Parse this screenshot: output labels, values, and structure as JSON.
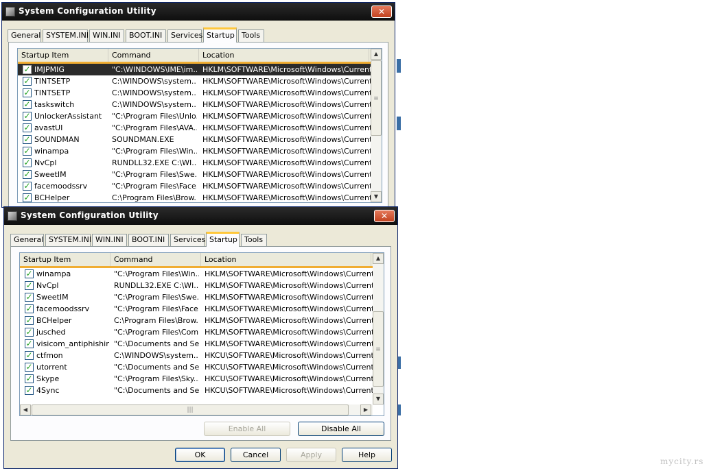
{
  "window_title": "System Configuration Utility",
  "close_glyph": "✕",
  "tabs": [
    "General",
    "SYSTEM.INI",
    "WIN.INI",
    "BOOT.INI",
    "Services",
    "Startup",
    "Tools"
  ],
  "active_tab": "Startup",
  "columns": [
    "Startup Item",
    "Command",
    "Location"
  ],
  "check_glyph": "✓",
  "top_window": {
    "rows": [
      {
        "item": "IMJPMIG",
        "command": "\"C:\\WINDOWS\\IME\\im...",
        "location": "HKLM\\SOFTWARE\\Microsoft\\Windows\\CurrentVer...",
        "checked": true
      },
      {
        "item": "TINTSETP",
        "command": "C:\\WINDOWS\\system...",
        "location": "HKLM\\SOFTWARE\\Microsoft\\Windows\\CurrentVer...",
        "checked": true
      },
      {
        "item": "TINTSETP",
        "command": "C:\\WINDOWS\\system...",
        "location": "HKLM\\SOFTWARE\\Microsoft\\Windows\\CurrentVer...",
        "checked": true
      },
      {
        "item": "taskswitch",
        "command": "C:\\WINDOWS\\system...",
        "location": "HKLM\\SOFTWARE\\Microsoft\\Windows\\CurrentVer...",
        "checked": true
      },
      {
        "item": "UnlockerAssistant",
        "command": "\"C:\\Program Files\\Unlo...",
        "location": "HKLM\\SOFTWARE\\Microsoft\\Windows\\CurrentVer...",
        "checked": true
      },
      {
        "item": "avastUI",
        "command": "\"C:\\Program Files\\AVA...",
        "location": "HKLM\\SOFTWARE\\Microsoft\\Windows\\CurrentVer...",
        "checked": true
      },
      {
        "item": "SOUNDMAN",
        "command": "SOUNDMAN.EXE",
        "location": "HKLM\\SOFTWARE\\Microsoft\\Windows\\CurrentVer...",
        "checked": true
      },
      {
        "item": "winampa",
        "command": "\"C:\\Program Files\\Win...",
        "location": "HKLM\\SOFTWARE\\Microsoft\\Windows\\CurrentVer...",
        "checked": true
      },
      {
        "item": "NvCpl",
        "command": "RUNDLL32.EXE C:\\WI...",
        "location": "HKLM\\SOFTWARE\\Microsoft\\Windows\\CurrentVer...",
        "checked": true
      },
      {
        "item": "SweetIM",
        "command": "\"C:\\Program Files\\Swe...",
        "location": "HKLM\\SOFTWARE\\Microsoft\\Windows\\CurrentVer...",
        "checked": true
      },
      {
        "item": "facemoodssrv",
        "command": "\"C:\\Program Files\\Face...",
        "location": "HKLM\\SOFTWARE\\Microsoft\\Windows\\CurrentVer...",
        "checked": true
      },
      {
        "item": "BCHelper",
        "command": "C:\\Program Files\\Brow...",
        "location": "HKLM\\SOFTWARE\\Microsoft\\Windows\\CurrentVer...",
        "checked": true
      }
    ],
    "selected_row": 0
  },
  "bottom_window": {
    "rows": [
      {
        "item": "winampa",
        "command": "\"C:\\Program Files\\Win...",
        "location": "HKLM\\SOFTWARE\\Microsoft\\Windows\\CurrentVer...",
        "checked": true
      },
      {
        "item": "NvCpl",
        "command": "RUNDLL32.EXE C:\\WI...",
        "location": "HKLM\\SOFTWARE\\Microsoft\\Windows\\CurrentVer...",
        "checked": true
      },
      {
        "item": "SweetIM",
        "command": "\"C:\\Program Files\\Swe...",
        "location": "HKLM\\SOFTWARE\\Microsoft\\Windows\\CurrentVer...",
        "checked": true
      },
      {
        "item": "facemoodssrv",
        "command": "\"C:\\Program Files\\Face...",
        "location": "HKLM\\SOFTWARE\\Microsoft\\Windows\\CurrentVer...",
        "checked": true
      },
      {
        "item": "BCHelper",
        "command": "C:\\Program Files\\Brow...",
        "location": "HKLM\\SOFTWARE\\Microsoft\\Windows\\CurrentVer...",
        "checked": true
      },
      {
        "item": "jusched",
        "command": "\"C:\\Program Files\\Com...",
        "location": "HKLM\\SOFTWARE\\Microsoft\\Windows\\CurrentVer...",
        "checked": true
      },
      {
        "item": "visicom_antiphishing",
        "command": "\"C:\\Documents and Se...",
        "location": "HKLM\\SOFTWARE\\Microsoft\\Windows\\CurrentVer...",
        "checked": true
      },
      {
        "item": "ctfmon",
        "command": "C:\\WINDOWS\\system...",
        "location": "HKCU\\SOFTWARE\\Microsoft\\Windows\\CurrentVer...",
        "checked": true
      },
      {
        "item": "utorrent",
        "command": "\"C:\\Documents and Se...",
        "location": "HKCU\\SOFTWARE\\Microsoft\\Windows\\CurrentVer...",
        "checked": true
      },
      {
        "item": "Skype",
        "command": "\"C:\\Program Files\\Sky...",
        "location": "HKCU\\SOFTWARE\\Microsoft\\Windows\\CurrentVer...",
        "checked": true
      },
      {
        "item": "4Sync",
        "command": "\"C:\\Documents and Se...",
        "location": "HKCU\\SOFTWARE\\Microsoft\\Windows\\CurrentVer...",
        "checked": true
      }
    ]
  },
  "buttons": {
    "enable_all": "Enable All",
    "disable_all": "Disable All",
    "ok": "OK",
    "cancel": "Cancel",
    "apply": "Apply",
    "help": "Help"
  },
  "scroll_glyphs": {
    "up": "▲",
    "down": "▼",
    "left": "◀",
    "right": "▶",
    "grip_v": "≡",
    "grip_h": "|||"
  },
  "watermark": "mycity.rs",
  "colors": {
    "titlebar": "#1a1a1a",
    "tab_highlight": "#ffc83c",
    "header_line": "#f0ad32",
    "dialog_bg": "#ece9d8"
  }
}
